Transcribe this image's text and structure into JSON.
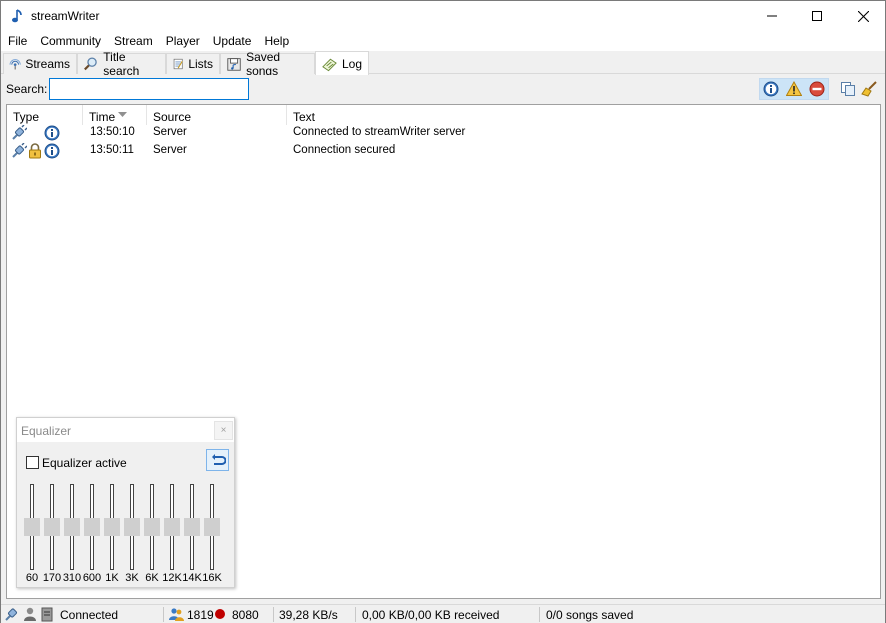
{
  "window": {
    "title": "streamWriter"
  },
  "menu": [
    "File",
    "Community",
    "Stream",
    "Player",
    "Update",
    "Help"
  ],
  "tabs": [
    {
      "label": "Streams",
      "icon": "radio-icon"
    },
    {
      "label": "Title search",
      "icon": "magnifier-icon"
    },
    {
      "label": "Lists",
      "icon": "list-icon"
    },
    {
      "label": "Saved songs",
      "icon": "saved-songs-icon"
    },
    {
      "label": "Log",
      "icon": "log-icon",
      "active": true
    }
  ],
  "search": {
    "label": "Search:",
    "value": ""
  },
  "toolbar": {
    "filter_info": "info-icon",
    "filter_warning": "warning-icon",
    "filter_error": "error-icon",
    "copy": "copy-icon",
    "clear": "broom-icon"
  },
  "log": {
    "columns": [
      "Type",
      "Time",
      "Source",
      "Text"
    ],
    "sort_column": "Time",
    "rows": [
      {
        "icons": [
          "plug-icon",
          "info-icon"
        ],
        "time": "13:50:10",
        "source": "Server",
        "text": "Connected to streamWriter server"
      },
      {
        "icons": [
          "plug-icon",
          "lock-icon",
          "info-icon"
        ],
        "time": "13:50:11",
        "source": "Server",
        "text": "Connection secured"
      }
    ]
  },
  "equalizer": {
    "title": "Equalizer",
    "close": "×",
    "active_label": "Equalizer active",
    "active": false,
    "bands": [
      "60",
      "170",
      "310",
      "600",
      "1K",
      "3K",
      "6K",
      "12K",
      "14K",
      "16K"
    ],
    "levels": [
      0,
      0,
      0,
      0,
      0,
      0,
      0,
      0,
      0,
      0
    ]
  },
  "status": {
    "connection": "Connected",
    "clients": "1819",
    "recordings": "8080",
    "speed": "39,28 KB/s",
    "received": "0,00 KB/0,00 KB received",
    "songs": "0/0 songs saved"
  },
  "colors": {
    "accent": "#0078d7",
    "toolbar_active": "#cce4f7",
    "record": "#c00000"
  }
}
